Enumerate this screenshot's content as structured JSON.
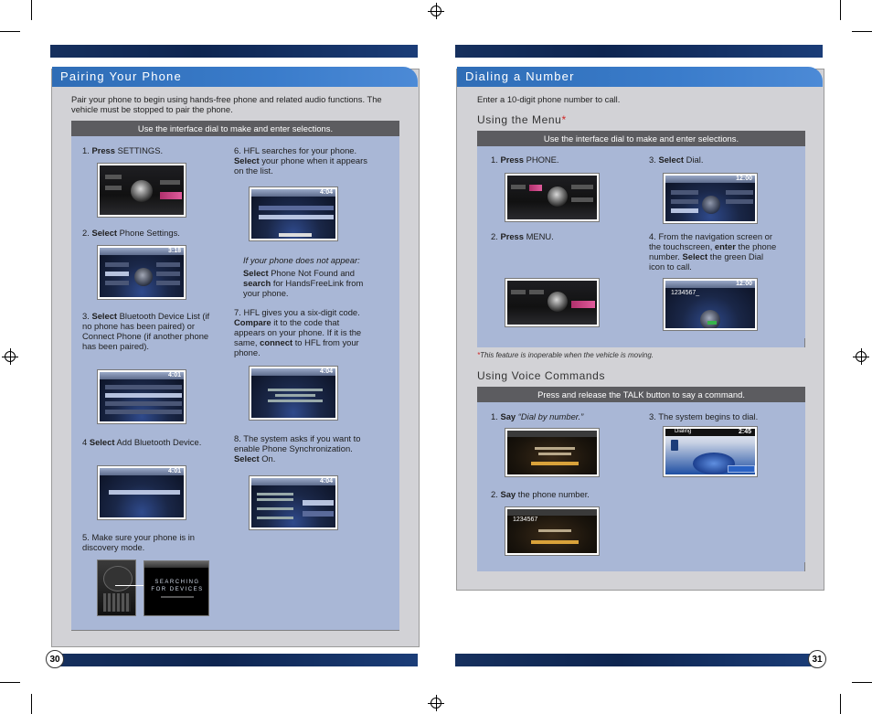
{
  "left": {
    "page_number": "30",
    "section_title": "Pairing Your Phone",
    "intro": "Pair your phone to begin using hands-free phone and related audio functions. The vehicle must be stopped to pair the phone.",
    "instruction_bar": "Use the interface dial to make and enter selections.",
    "steps": {
      "s1": {
        "num": "1.",
        "verb": "Press",
        "rest": " SETTINGS."
      },
      "s2": {
        "num": "2.",
        "verb": "Select",
        "rest": " Phone Settings."
      },
      "s3": {
        "num": "3.",
        "verb": "Select",
        "rest": " Bluetooth Device List (if no phone has been paired) or Connect Phone (if another phone has been paired)."
      },
      "s4": {
        "num": "4",
        "verb": "Select",
        "rest": " Add Bluetooth Device."
      },
      "s5": {
        "num": "5.",
        "text": "Make sure your phone is in discovery mode."
      },
      "s6": {
        "num": "6.",
        "pre": "HFL searches for your phone. ",
        "verb": "Select",
        "rest": " your phone when it appears on the list."
      },
      "s6_note_heading": "If your phone does not appear:",
      "s6_note": {
        "verb1": "Select",
        "mid1": " Phone Not Found and ",
        "verb2": "search",
        "mid2": " for HandsFreeLink from your phone."
      },
      "s7": {
        "num": "7.",
        "pre": "HFL gives you a six-digit code. ",
        "verb1": "Compare",
        "mid": " it to the code that appears on your phone. If it is the same, ",
        "verb2": "connect",
        "rest": " to HFL from your phone."
      },
      "s8": {
        "num": "8.",
        "pre": "The system asks if you want to enable Phone Synchronization. ",
        "verb": "Select",
        "rest": " On."
      }
    },
    "screens": {
      "settings_time": "3:18",
      "bt_time": "4:01",
      "add_time": "4:01",
      "found_time": "4:04",
      "code_time": "4:04",
      "sync_time": "4:04",
      "searching_line1": "SEARCHING",
      "searching_line2": "FOR DEVICES"
    }
  },
  "right": {
    "page_number": "31",
    "section_title": "Dialing a Number",
    "intro": "Enter a 10-digit phone number to call.",
    "menu_heading": "Using the Menu",
    "menu_star": "*",
    "menu_bar": "Use the interface dial to make and enter selections.",
    "menu_steps": {
      "m1": {
        "num": "1.",
        "verb": "Press",
        "rest": " PHONE."
      },
      "m2": {
        "num": "2.",
        "verb": "Press",
        "rest": " MENU."
      },
      "m3": {
        "num": "3.",
        "verb": "Select",
        "rest": " Dial."
      },
      "m4": {
        "num": "4.",
        "pre": "From the navigation screen or the touchscreen, ",
        "verb1": "enter",
        "mid": " the phone number. ",
        "verb2": "Select",
        "rest": " the green Dial icon to call."
      }
    },
    "footnote_star": "*",
    "footnote": "This feature is inoperable when the vehicle is moving.",
    "voice_heading": "Using Voice Commands",
    "voice_bar": "Press and release the TALK button to say a command.",
    "voice_steps": {
      "v1": {
        "num": "1.",
        "verb": "Say",
        "quote": " “Dial by number.”"
      },
      "v2": {
        "num": "2.",
        "verb": "Say",
        "rest": " the phone number."
      },
      "v3": {
        "num": "3.",
        "text": "The system begins to dial."
      }
    },
    "screens": {
      "menu_time": "12:00",
      "dial_time": "12:00",
      "dial_entry": "1234567_",
      "voice_number": "1234567",
      "dialing_label": "Dialing",
      "dialing_time": "2:45"
    }
  }
}
